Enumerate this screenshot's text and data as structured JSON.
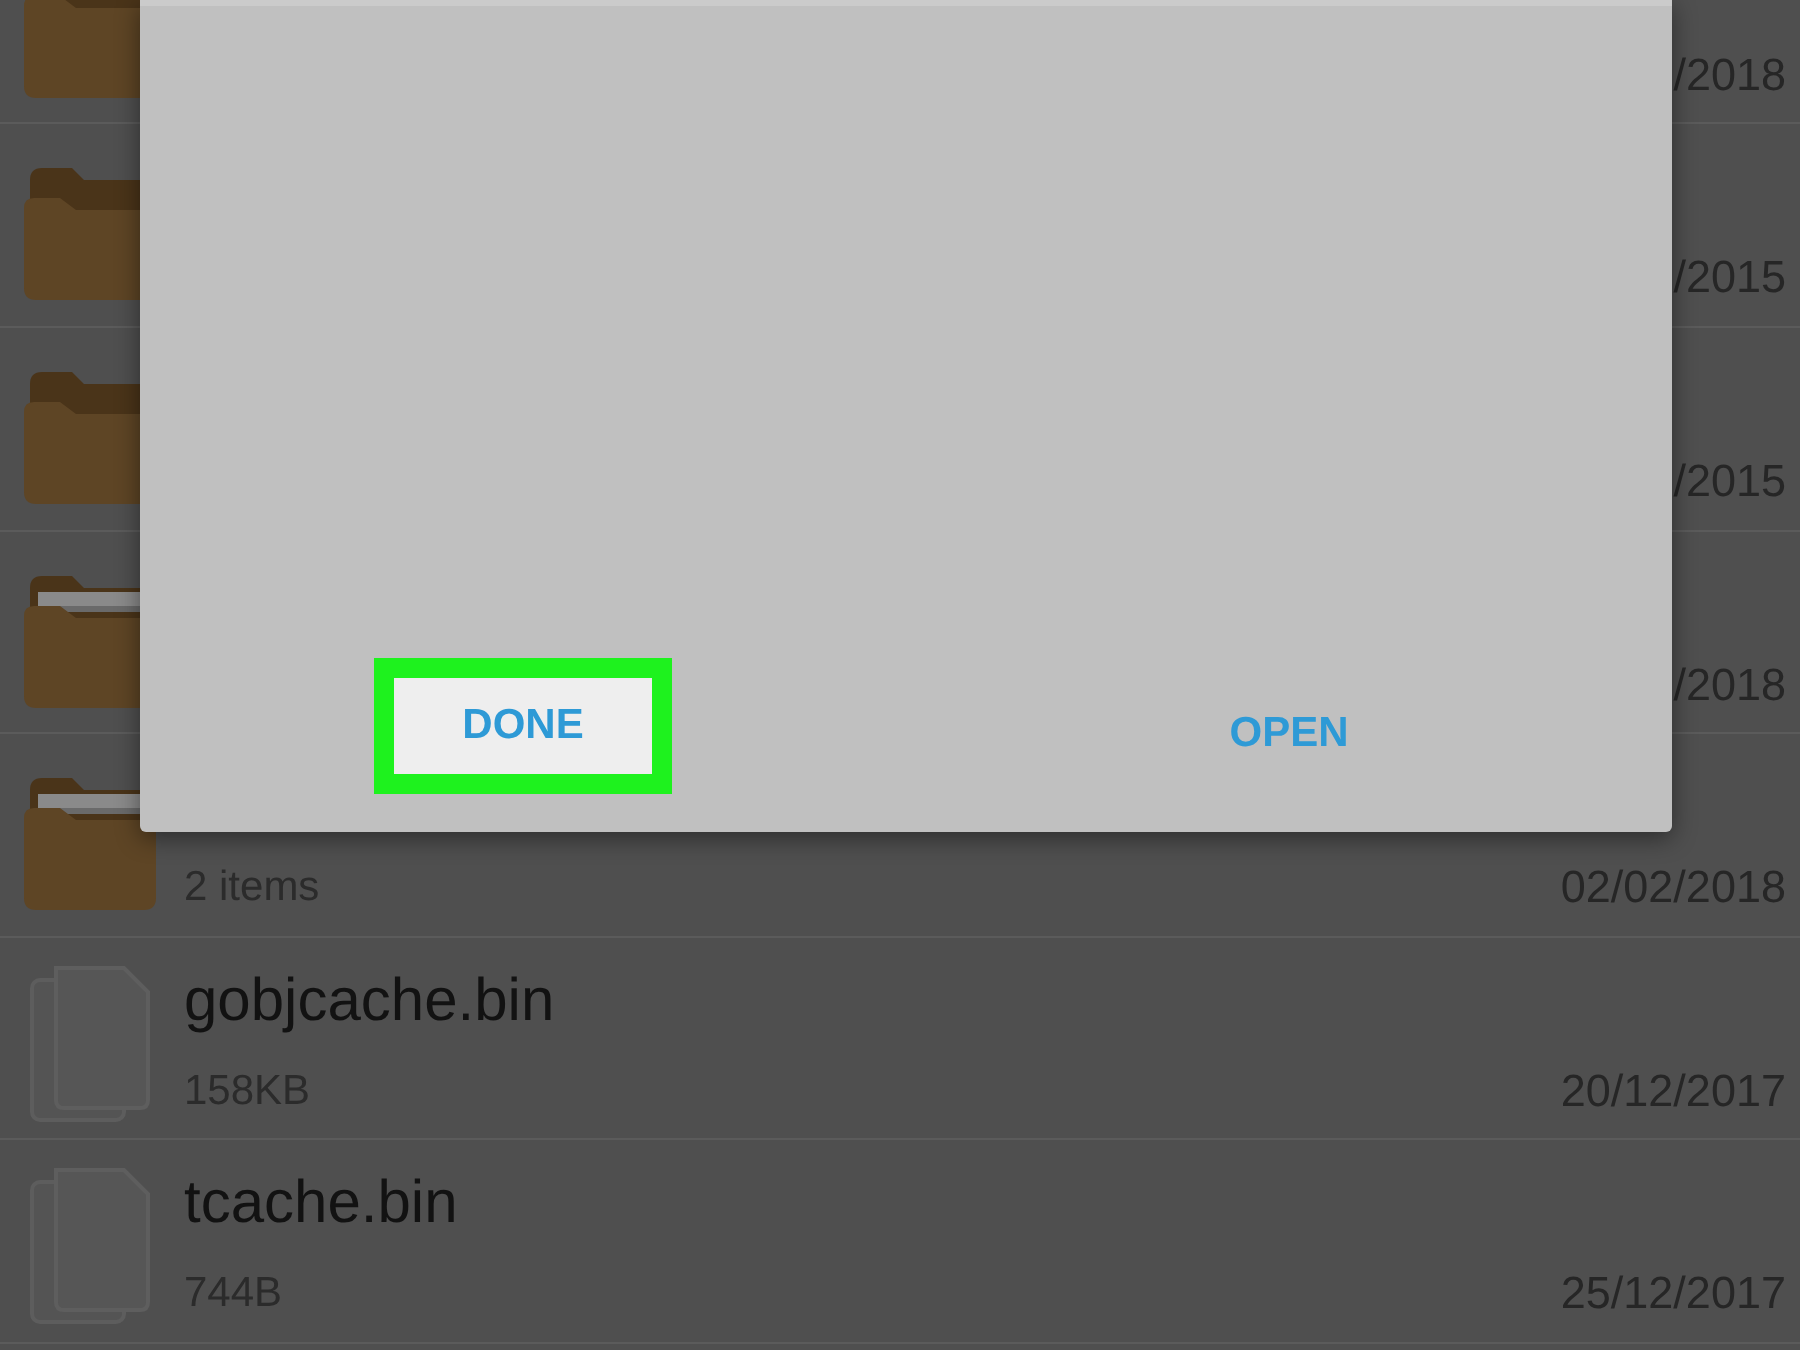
{
  "file_list": [
    {
      "kind": "folder",
      "date": "/2018"
    },
    {
      "kind": "folder",
      "date": "/2015"
    },
    {
      "kind": "folder",
      "date": "/2015"
    },
    {
      "kind": "folder-docs",
      "date": "/2018"
    },
    {
      "kind": "folder-docs",
      "detail": "2 items",
      "date": "02/02/2018"
    },
    {
      "kind": "file",
      "name": "gobjcache.bin",
      "detail": "158KB",
      "date": "20/12/2017"
    },
    {
      "kind": "file",
      "name": "tcache.bin",
      "detail": "744B",
      "date": "25/12/2017"
    }
  ],
  "dialog": {
    "buttons": [
      {
        "label": "DONE",
        "highlighted": true
      },
      {
        "label": "OPEN",
        "highlighted": false
      }
    ]
  }
}
